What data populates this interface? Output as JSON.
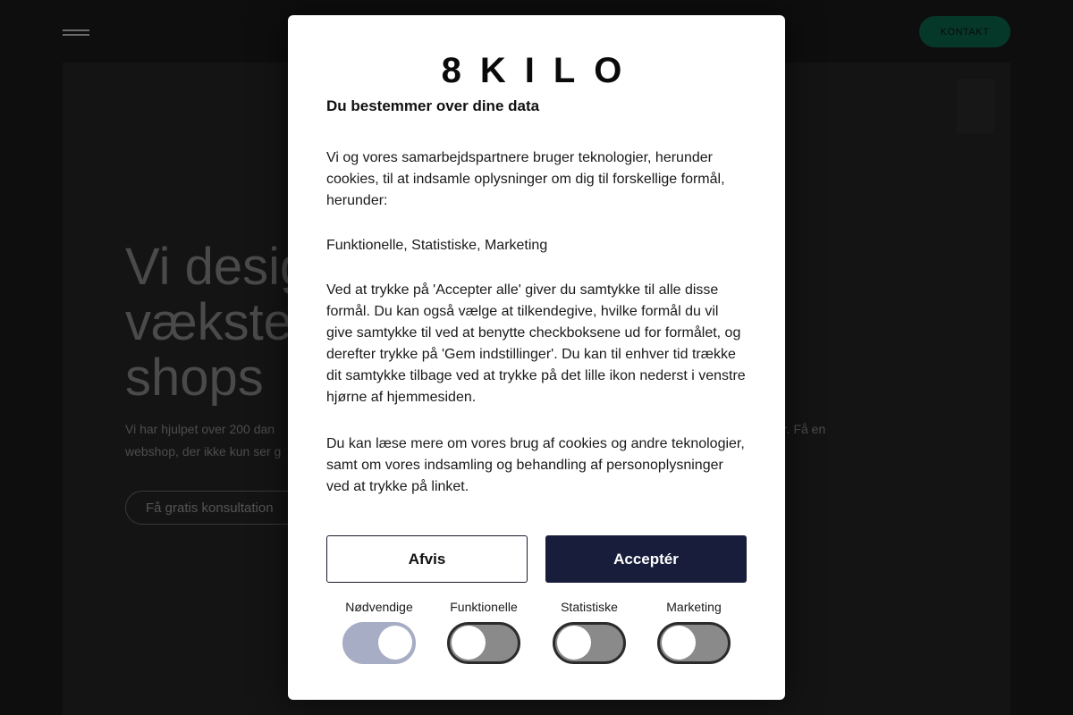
{
  "site": {
    "contact_label": "KONTAKT",
    "hero_title_lines": [
      "Vi desig",
      "vækste",
      "shops"
    ],
    "hero_sub_line1": "Vi har hjulpet over 200 dan",
    "hero_sub_line1_right": "er. Få en",
    "hero_sub_line2": "webshop, der ikke kun ser g",
    "consult_label": "Få gratis konsultation"
  },
  "modal": {
    "logo": "8KILO",
    "heading": "Du bestemmer over dine data",
    "paragraphs": [
      "Vi og vores samarbejdspartnere bruger teknologier, herunder cookies, til at indsamle oplysninger om dig til forskellige formål, herunder:",
      "Funktionelle, Statistiske, Marketing",
      "Ved at trykke på 'Accepter alle' giver du samtykke til alle disse formål. Du kan også vælge at tilkendegive, hvilke formål du vil give samtykke til ved at benytte checkboksene ud for formålet, og derefter trykke på 'Gem indstillinger'. Du kan til enhver tid trække dit samtykke tilbage ved at trykke på det lille ikon nederst i venstre hjørne af hjemmesiden.",
      "Du kan læse mere om vores brug af cookies og andre teknologier, samt om vores indsamling og behandling af personoplysninger ved at trykke på linket."
    ],
    "reject_label": "Afvis",
    "accept_label": "Acceptér",
    "toggles": [
      {
        "label": "Nødvendige",
        "state": "on"
      },
      {
        "label": "Funktionelle",
        "state": "off"
      },
      {
        "label": "Statistiske",
        "state": "off"
      },
      {
        "label": "Marketing",
        "state": "off"
      }
    ]
  },
  "colors": {
    "accept_bg": "#171d3b",
    "toggle_on": "#a7adc4",
    "toggle_off": "#8a8a8a",
    "contact_bg": "#06382a"
  }
}
